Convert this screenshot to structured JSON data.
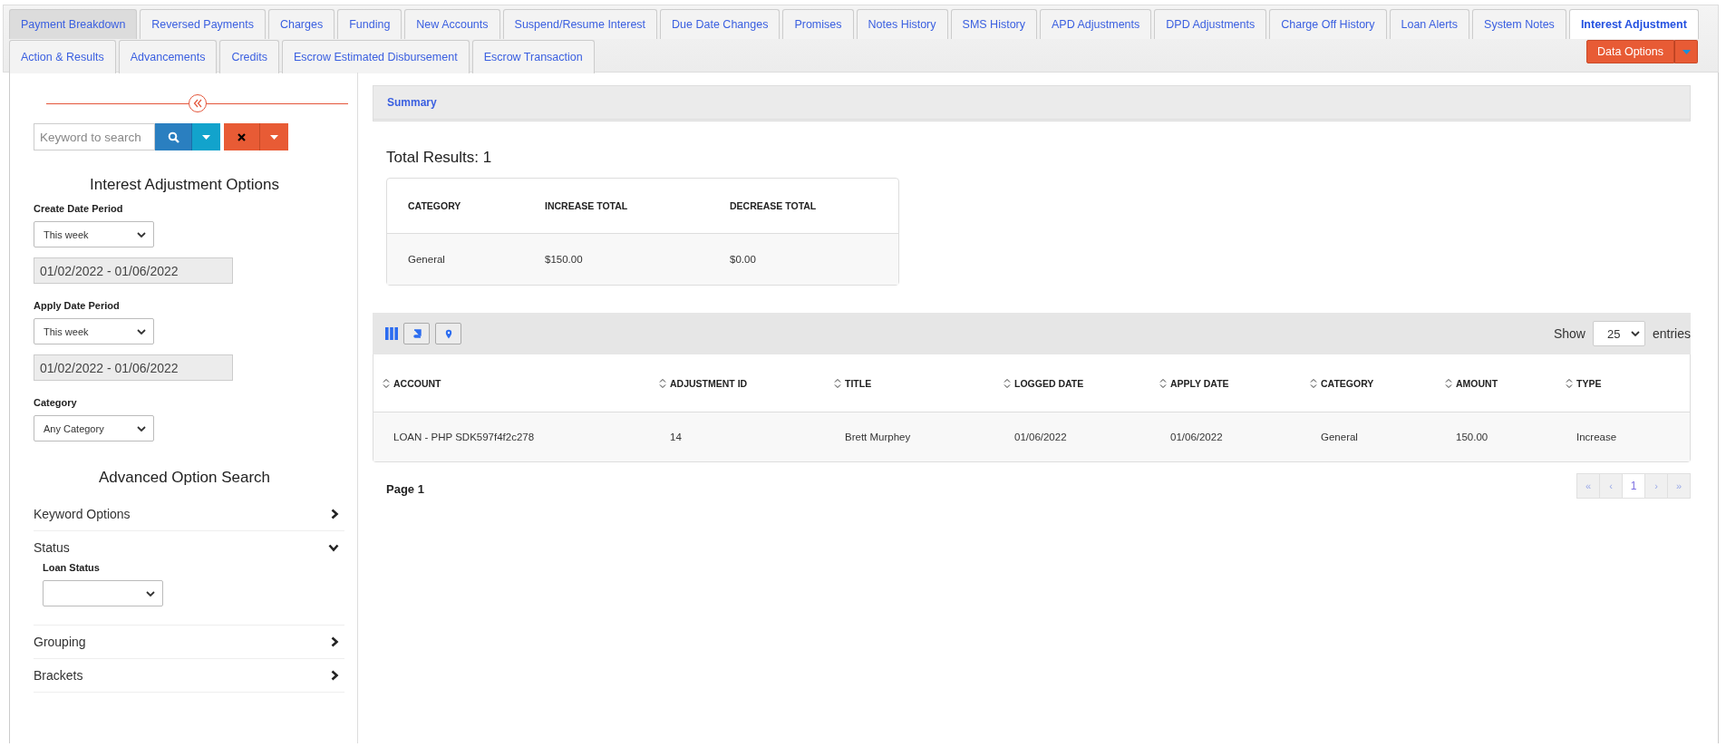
{
  "tabs": [
    {
      "label": "Payment Breakdown",
      "selected": false,
      "hovered": true
    },
    {
      "label": "Reversed Payments",
      "selected": false,
      "hovered": false
    },
    {
      "label": "Charges",
      "selected": false,
      "hovered": false
    },
    {
      "label": "Funding",
      "selected": false,
      "hovered": false
    },
    {
      "label": "New Accounts",
      "selected": false,
      "hovered": false
    },
    {
      "label": "Suspend/Resume Interest",
      "selected": false,
      "hovered": false
    },
    {
      "label": "Due Date Changes",
      "selected": false,
      "hovered": false
    },
    {
      "label": "Promises",
      "selected": false,
      "hovered": false
    },
    {
      "label": "Notes History",
      "selected": false,
      "hovered": false
    },
    {
      "label": "SMS History",
      "selected": false,
      "hovered": false
    },
    {
      "label": "APD Adjustments",
      "selected": false,
      "hovered": false
    },
    {
      "label": "DPD Adjustments",
      "selected": false,
      "hovered": false
    },
    {
      "label": "Charge Off History",
      "selected": false,
      "hovered": false
    },
    {
      "label": "Loan Alerts",
      "selected": false,
      "hovered": false
    },
    {
      "label": "System Notes",
      "selected": false,
      "hovered": false
    },
    {
      "label": "Interest Adjustment",
      "selected": true,
      "hovered": false
    },
    {
      "label": "Action & Results",
      "selected": false,
      "hovered": false
    },
    {
      "label": "Advancements",
      "selected": false,
      "hovered": false
    },
    {
      "label": "Credits",
      "selected": false,
      "hovered": false
    },
    {
      "label": "Escrow Estimated Disbursement",
      "selected": false,
      "hovered": false
    },
    {
      "label": "Escrow Transaction",
      "selected": false,
      "hovered": false
    }
  ],
  "data_options_button": "Data Options",
  "sidebar": {
    "search": {
      "placeholder": "Keyword to search"
    },
    "title": "Interest Adjustment Options",
    "filters": [
      {
        "kind": "select",
        "label": "Create Date Period",
        "value": "This week"
      },
      {
        "kind": "date",
        "value": "01/02/2022 - 01/06/2022"
      },
      {
        "kind": "select",
        "label": "Apply Date Period",
        "value": "This week"
      },
      {
        "kind": "date",
        "value": "01/02/2022 - 01/06/2022"
      },
      {
        "kind": "select",
        "label": "Category",
        "value": "Any Category"
      }
    ],
    "advanced_title": "Advanced Option Search",
    "sections": [
      {
        "label": "Keyword Options",
        "expanded": false
      },
      {
        "label": "Status",
        "expanded": true,
        "fields": [
          {
            "label": "Loan Status"
          }
        ]
      },
      {
        "label": "Grouping",
        "expanded": false
      },
      {
        "label": "Brackets",
        "expanded": false
      }
    ]
  },
  "summary": {
    "header": "Summary",
    "total": "Total Results: 1",
    "columns": [
      "CATEGORY",
      "INCREASE TOTAL",
      "DECREASE TOTAL"
    ],
    "rows": [
      [
        "General",
        "$150.00",
        "$0.00"
      ]
    ]
  },
  "table": {
    "show_label": "Show",
    "page_size": "25",
    "entries_label": "entries",
    "columns": [
      "ACCOUNT",
      "ADJUSTMENT ID",
      "TITLE",
      "LOGGED DATE",
      "APPLY DATE",
      "CATEGORY",
      "AMOUNT",
      "TYPE"
    ],
    "rows": [
      [
        "LOAN - PHP SDK597f4f2c278",
        "14",
        "Brett Murphey",
        "01/06/2022",
        "01/06/2022",
        "General",
        "150.00",
        "Increase"
      ]
    ],
    "page_label": "Page 1",
    "pagination": [
      {
        "label": "«",
        "selected": false
      },
      {
        "label": "‹",
        "selected": false
      },
      {
        "label": "1",
        "selected": true
      },
      {
        "label": "›",
        "selected": false
      },
      {
        "label": "»",
        "selected": false
      }
    ]
  }
}
